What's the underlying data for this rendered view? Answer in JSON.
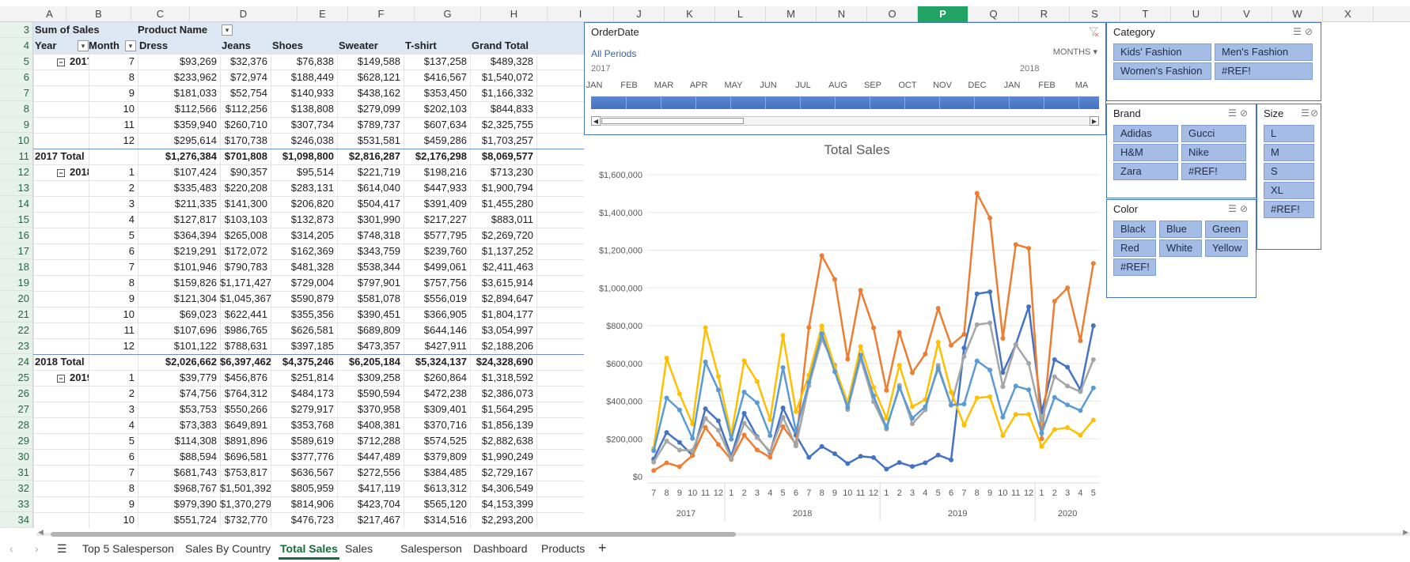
{
  "columns": [
    "A",
    "B",
    "C",
    "D",
    "E",
    "F",
    "G",
    "H",
    "I",
    "J",
    "K",
    "L",
    "M",
    "N",
    "O",
    "P",
    "Q",
    "R",
    "S",
    "T",
    "U",
    "V",
    "W",
    "X"
  ],
  "selected_column": "P",
  "pivot": {
    "header1_label": "Sum of Sales",
    "header1_col": "Product Name",
    "year_label": "Year",
    "month_label": "Month",
    "product_headers": [
      "Dress",
      "Jeans",
      "Shoes",
      "Sweater",
      "T-shirt",
      "Grand Total"
    ],
    "rows": [
      {
        "rn": "5",
        "year": "2017",
        "month": "7",
        "v": [
          "$93,269",
          "$32,376",
          "$76,838",
          "$149,588",
          "$137,258",
          "$489,328"
        ]
      },
      {
        "rn": "6",
        "month": "8",
        "v": [
          "$233,962",
          "$72,974",
          "$188,449",
          "$628,121",
          "$416,567",
          "$1,540,072"
        ]
      },
      {
        "rn": "7",
        "month": "9",
        "v": [
          "$181,033",
          "$52,754",
          "$140,933",
          "$438,162",
          "$353,450",
          "$1,166,332"
        ]
      },
      {
        "rn": "8",
        "month": "10",
        "v": [
          "$112,566",
          "$112,256",
          "$138,808",
          "$279,099",
          "$202,103",
          "$844,833"
        ]
      },
      {
        "rn": "9",
        "month": "11",
        "v": [
          "$359,940",
          "$260,710",
          "$307,734",
          "$789,737",
          "$607,634",
          "$2,325,755"
        ]
      },
      {
        "rn": "10",
        "month": "12",
        "v": [
          "$295,614",
          "$170,738",
          "$246,038",
          "$531,581",
          "$459,286",
          "$1,703,257"
        ]
      },
      {
        "rn": "11",
        "total": "2017 Total",
        "v": [
          "$1,276,384",
          "$701,808",
          "$1,098,800",
          "$2,816,287",
          "$2,176,298",
          "$8,069,577"
        ]
      },
      {
        "rn": "12",
        "year": "2018",
        "month": "1",
        "v": [
          "$107,424",
          "$90,357",
          "$95,514",
          "$221,719",
          "$198,216",
          "$713,230"
        ]
      },
      {
        "rn": "13",
        "month": "2",
        "v": [
          "$335,483",
          "$220,208",
          "$283,131",
          "$614,040",
          "$447,933",
          "$1,900,794"
        ]
      },
      {
        "rn": "14",
        "month": "3",
        "v": [
          "$211,335",
          "$141,300",
          "$206,820",
          "$504,417",
          "$391,409",
          "$1,455,280"
        ]
      },
      {
        "rn": "15",
        "month": "4",
        "v": [
          "$127,817",
          "$103,103",
          "$132,873",
          "$301,990",
          "$217,227",
          "$883,011"
        ]
      },
      {
        "rn": "16",
        "month": "5",
        "v": [
          "$364,394",
          "$265,008",
          "$314,205",
          "$748,318",
          "$577,795",
          "$2,269,720"
        ]
      },
      {
        "rn": "17",
        "month": "6",
        "v": [
          "$219,291",
          "$172,072",
          "$162,369",
          "$343,759",
          "$239,760",
          "$1,137,252"
        ]
      },
      {
        "rn": "18",
        "month": "7",
        "v": [
          "$101,946",
          "$790,783",
          "$481,328",
          "$538,344",
          "$499,061",
          "$2,411,463"
        ]
      },
      {
        "rn": "19",
        "month": "8",
        "v": [
          "$159,826",
          "$1,171,427",
          "$729,004",
          "$797,901",
          "$757,756",
          "$3,615,914"
        ]
      },
      {
        "rn": "20",
        "month": "9",
        "v": [
          "$121,304",
          "$1,045,367",
          "$590,879",
          "$581,078",
          "$556,019",
          "$2,894,647"
        ]
      },
      {
        "rn": "21",
        "month": "10",
        "v": [
          "$69,023",
          "$622,441",
          "$355,356",
          "$390,451",
          "$366,905",
          "$1,804,177"
        ]
      },
      {
        "rn": "22",
        "month": "11",
        "v": [
          "$107,696",
          "$986,765",
          "$626,581",
          "$689,809",
          "$644,146",
          "$3,054,997"
        ]
      },
      {
        "rn": "23",
        "month": "12",
        "v": [
          "$101,122",
          "$788,631",
          "$397,185",
          "$473,357",
          "$427,911",
          "$2,188,206"
        ]
      },
      {
        "rn": "24",
        "total": "2018 Total",
        "v": [
          "$2,026,662",
          "$6,397,462",
          "$4,375,246",
          "$6,205,184",
          "$5,324,137",
          "$24,328,690"
        ]
      },
      {
        "rn": "25",
        "year": "2019",
        "month": "1",
        "v": [
          "$39,779",
          "$456,876",
          "$251,814",
          "$309,258",
          "$260,864",
          "$1,318,592"
        ]
      },
      {
        "rn": "26",
        "month": "2",
        "v": [
          "$74,756",
          "$764,312",
          "$484,173",
          "$590,594",
          "$472,238",
          "$2,386,073"
        ]
      },
      {
        "rn": "27",
        "month": "3",
        "v": [
          "$53,753",
          "$550,266",
          "$279,917",
          "$370,958",
          "$309,401",
          "$1,564,295"
        ]
      },
      {
        "rn": "28",
        "month": "4",
        "v": [
          "$73,383",
          "$649,891",
          "$353,768",
          "$408,381",
          "$370,716",
          "$1,856,139"
        ]
      },
      {
        "rn": "29",
        "month": "5",
        "v": [
          "$114,308",
          "$891,896",
          "$589,619",
          "$712,288",
          "$574,525",
          "$2,882,638"
        ]
      },
      {
        "rn": "30",
        "month": "6",
        "v": [
          "$88,594",
          "$696,581",
          "$377,776",
          "$447,489",
          "$379,809",
          "$1,990,249"
        ]
      },
      {
        "rn": "31",
        "month": "7",
        "v": [
          "$681,743",
          "$753,817",
          "$636,567",
          "$272,556",
          "$384,485",
          "$2,729,167"
        ]
      },
      {
        "rn": "32",
        "month": "8",
        "v": [
          "$968,767",
          "$1,501,392",
          "$805,959",
          "$417,119",
          "$613,312",
          "$4,306,549"
        ]
      },
      {
        "rn": "33",
        "month": "9",
        "v": [
          "$979,390",
          "$1,370,279",
          "$814,906",
          "$423,704",
          "$565,120",
          "$4,153,399"
        ]
      },
      {
        "rn": "34",
        "month": "10",
        "v": [
          "$551,724",
          "$732,770",
          "$476,723",
          "$217,467",
          "$314,516",
          "$2,293,200"
        ]
      }
    ]
  },
  "timeline": {
    "title": "OrderDate",
    "all_periods": "All Periods",
    "level": "MONTHS",
    "years": [
      "2017",
      "2018"
    ],
    "months": [
      "JAN",
      "FEB",
      "MAR",
      "APR",
      "MAY",
      "JUN",
      "JUL",
      "AUG",
      "SEP",
      "OCT",
      "NOV",
      "DEC",
      "JAN",
      "FEB",
      "MA"
    ]
  },
  "slicers": {
    "category": {
      "title": "Category",
      "items": [
        "Kids' Fashion",
        "Men's Fashion",
        "Women's Fashion",
        "#REF!"
      ]
    },
    "brand": {
      "title": "Brand",
      "items": [
        "Adidas",
        "Gucci",
        "H&M",
        "Nike",
        "Zara",
        "#REF!"
      ]
    },
    "size": {
      "title": "Size",
      "items": [
        "L",
        "M",
        "S",
        "XL",
        "#REF!"
      ]
    },
    "color": {
      "title": "Color",
      "items": [
        "Black",
        "Blue",
        "Green",
        "Red",
        "White",
        "Yellow",
        "#REF!"
      ]
    }
  },
  "chart_data": {
    "type": "line",
    "title": "Total Sales",
    "ylim": [
      0,
      1600000
    ],
    "ytick_labels": [
      "$0",
      "$200,000",
      "$400,000",
      "$600,000",
      "$800,000",
      "$1,000,000",
      "$1,200,000",
      "$1,400,000",
      "$1,600,000"
    ],
    "x": [
      "7",
      "8",
      "9",
      "10",
      "11",
      "12",
      "1",
      "2",
      "3",
      "4",
      "5",
      "6",
      "7",
      "8",
      "9",
      "10",
      "11",
      "12",
      "1",
      "2",
      "3",
      "4",
      "5",
      "6",
      "7",
      "8",
      "9",
      "10",
      "11",
      "12",
      "1",
      "2",
      "3",
      "4",
      "5"
    ],
    "year_groups": [
      {
        "label": "2017",
        "count": 6
      },
      {
        "label": "2018",
        "count": 12
      },
      {
        "label": "2019",
        "count": 12
      },
      {
        "label": "2020",
        "count": 5
      }
    ],
    "colors": {
      "dress": "#4472c4",
      "jeans": "#ed7d31",
      "shoes": "#a5a5a5",
      "sweater": "#ffc000",
      "tshirt": "#5b9bd5"
    },
    "series": [
      {
        "key": "dress",
        "values": [
          93269,
          233962,
          181033,
          112566,
          359940,
          295614,
          107424,
          335483,
          211335,
          127817,
          364394,
          219291,
          101946,
          159826,
          121304,
          69023,
          107696,
          101122,
          39779,
          74756,
          53753,
          73383,
          114308,
          88594,
          681743,
          968767,
          979390,
          551724,
          700000,
          900000,
          340000,
          620000,
          580000,
          460000,
          800000
        ]
      },
      {
        "key": "jeans",
        "values": [
          32376,
          72974,
          52754,
          112256,
          260710,
          170738,
          90357,
          220208,
          141300,
          103103,
          265008,
          172072,
          790783,
          1171427,
          1045367,
          622441,
          986765,
          788631,
          456876,
          764312,
          550266,
          649891,
          891896,
          696581,
          753817,
          1501392,
          1370279,
          732770,
          1230000,
          1210000,
          200000,
          930000,
          1000000,
          720000,
          1130000
        ]
      },
      {
        "key": "shoes",
        "values": [
          76838,
          188449,
          140933,
          138808,
          307734,
          246038,
          95514,
          283131,
          206820,
          132873,
          314205,
          162369,
          481328,
          729004,
          590879,
          355356,
          626581,
          397185,
          251814,
          484173,
          279917,
          353768,
          589619,
          377776,
          636567,
          805959,
          814906,
          476723,
          700000,
          600000,
          300000,
          530000,
          480000,
          450000,
          620000
        ]
      },
      {
        "key": "sweater",
        "values": [
          149588,
          628121,
          438162,
          279099,
          789737,
          531581,
          221719,
          614040,
          504417,
          301990,
          748318,
          343759,
          538344,
          797901,
          581078,
          390451,
          689809,
          473357,
          309258,
          590594,
          370958,
          408381,
          712288,
          447489,
          272556,
          417119,
          423704,
          217467,
          330000,
          330000,
          160000,
          250000,
          260000,
          220000,
          300000
        ]
      },
      {
        "key": "tshirt",
        "values": [
          137258,
          416567,
          353450,
          202103,
          607634,
          459286,
          198216,
          447933,
          391409,
          217227,
          577795,
          239760,
          499061,
          757756,
          556019,
          366905,
          644146,
          427911,
          260864,
          472238,
          309401,
          370716,
          574525,
          379809,
          384485,
          613312,
          565120,
          314516,
          480000,
          460000,
          230000,
          420000,
          380000,
          350000,
          470000
        ]
      }
    ]
  },
  "sheet_tabs": [
    "Top 5 Salesperson",
    "Sales By Country",
    "Total Sales",
    "Sales",
    "Salesperson",
    "Dashboard",
    "Products"
  ],
  "active_tab": "Total Sales"
}
